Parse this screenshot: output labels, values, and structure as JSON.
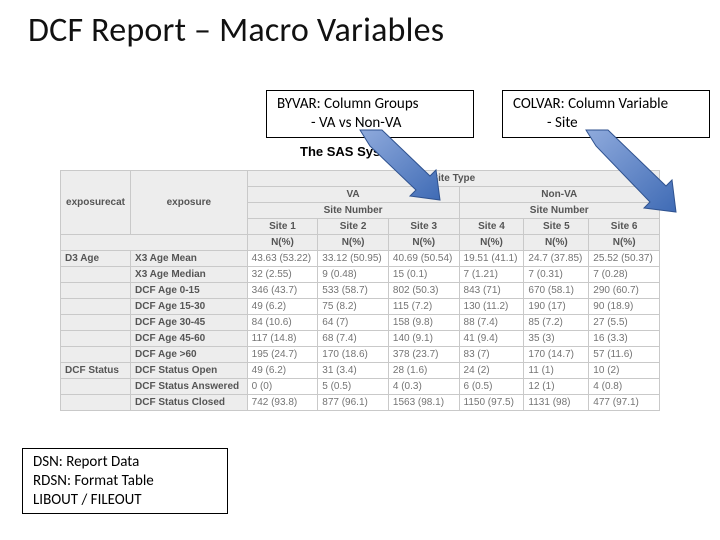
{
  "title": "DCF Report – Macro Variables",
  "callouts": {
    "byvar": {
      "l1": "BYVAR: Column Groups",
      "l2": "- VA vs Non-VA"
    },
    "colvar": {
      "l1": "COLVAR: Column Variable",
      "l2": "- Site"
    },
    "dsn": {
      "l1": "DSN: Report Data",
      "l2": "RDSN: Format Table",
      "l3": "LIBOUT / FILEOUT"
    }
  },
  "sas_title": "The SAS System",
  "table": {
    "topgroup_label": "Site Type",
    "groups": [
      {
        "label": "VA",
        "sitenum_label": "Site Number",
        "sites": [
          "Site 1",
          "Site 2",
          "Site 3"
        ]
      },
      {
        "label": "Non-VA",
        "sitenum_label": "Site Number",
        "sites": [
          "Site 4",
          "Site 5",
          "Site 6"
        ]
      }
    ],
    "rowhdr": {
      "cat": "exposurecat",
      "exp": "exposure",
      "metric": "N(%)"
    },
    "rows": [
      {
        "cat": "D3  Age",
        "exp": "X3  Age Mean",
        "v": [
          "43.63 (53.22)",
          "33.12 (50.95)",
          "40.69 (50.54)",
          "19.51 (41.1)",
          "24.7 (37.85)",
          "25.52 (50.37)"
        ]
      },
      {
        "cat": "",
        "exp": "X3  Age Median",
        "v": [
          "32 (2.55)",
          "9 (0.48)",
          "15 (0.1)",
          "7 (1.21)",
          "7 (0.31)",
          "7 (0.28)"
        ]
      },
      {
        "cat": "",
        "exp": "DCF Age 0-15",
        "v": [
          "346 (43.7)",
          "533 (58.7)",
          "802 (50.3)",
          "843 (71)",
          "670 (58.1)",
          "290 (60.7)"
        ]
      },
      {
        "cat": "",
        "exp": "DCF Age 15-30",
        "v": [
          "49 (6.2)",
          "75 (8.2)",
          "115 (7.2)",
          "130 (11.2)",
          "190 (17)",
          "90 (18.9)"
        ]
      },
      {
        "cat": "",
        "exp": "DCF Age 30-45",
        "v": [
          "84 (10.6)",
          "64 (7)",
          "158 (9.8)",
          "88 (7.4)",
          "85 (7.2)",
          "27 (5.5)"
        ]
      },
      {
        "cat": "",
        "exp": "DCF Age 45-60",
        "v": [
          "117 (14.8)",
          "68 (7.4)",
          "140 (9.1)",
          "41 (9.4)",
          "35 (3)",
          "16 (3.3)"
        ]
      },
      {
        "cat": "",
        "exp": "DCF Age >60",
        "v": [
          "195 (24.7)",
          "170 (18.6)",
          "378 (23.7)",
          "83 (7)",
          "170 (14.7)",
          "57 (11.6)"
        ]
      },
      {
        "cat": "DCF Status",
        "exp": "DCF Status Open",
        "v": [
          "49 (6.2)",
          "31 (3.4)",
          "28 (1.6)",
          "24 (2)",
          "11 (1)",
          "10 (2)"
        ]
      },
      {
        "cat": "",
        "exp": "DCF Status Answered",
        "v": [
          "0 (0)",
          "5 (0.5)",
          "4 (0.3)",
          "6 (0.5)",
          "12 (1)",
          "4 (0.8)"
        ]
      },
      {
        "cat": "",
        "exp": "DCF Status Closed",
        "v": [
          "742 (93.8)",
          "877 (96.1)",
          "1563 (98.1)",
          "1150 (97.5)",
          "1131 (98)",
          "477 (97.1)"
        ]
      }
    ]
  }
}
